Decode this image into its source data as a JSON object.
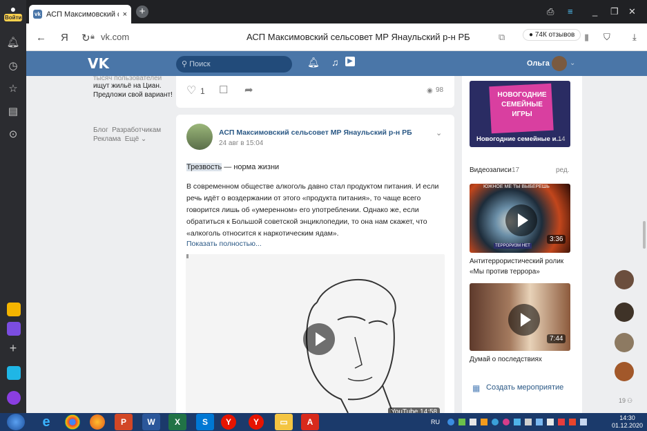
{
  "browser": {
    "login_label": "Войти",
    "tab_title": "АСП Максимовский се",
    "tab_close": "×",
    "new_tab": "+",
    "nav_back": "←",
    "nav_ya": "Я",
    "nav_reload": "↻",
    "url": "vk.com",
    "page_title": "АСП Максимовский сельсовет МР Янаульский р-н РБ",
    "reviews": "74К отзывов"
  },
  "vk": {
    "logo": "VK",
    "search_placeholder": "Поиск",
    "user_name": "Ольга"
  },
  "left": {
    "ad_line1": "тысяч пользователей",
    "ad_line2": "ищут жильё на Циан.",
    "ad_line3": "Предложи свой вариант!",
    "blog": "Блог",
    "developers": "Разработчикам",
    "ads": "Реклама",
    "more": "Ещё ⌄"
  },
  "prev_post": {
    "likes": "1",
    "views": "98"
  },
  "post": {
    "author": "АСП Максимовский сельсовет МР Янаульский р-н РБ",
    "date": "24 авг в 15:04",
    "headline_word": "Трезвость",
    "headline_rest": " — норма жизни",
    "body": "В современном обществе алкоголь давно стал продуктом питания. И если речь идёт о воздержании от этого «продукта питания», то чаще всего говорится лишь об «умеренном» его употреблении. Однако же, если обратиться к Большой советской энциклопедии, то она нам скажет, что «алкоголь относится к наркотическим ядам».",
    "show_more": "Показать полностью...",
    "video_badge": "YouTube 14:58"
  },
  "right": {
    "game_logo_line1": "НОВОГОДНИЕ",
    "game_logo_line2": "СЕМЕЙНЫЕ",
    "game_logo_line3": "ИГРЫ",
    "game_caption": "Новогодние семейные и...",
    "game_count": "14",
    "videos_title": "Видеозаписи",
    "videos_count": "17",
    "videos_edit": "ред.",
    "video1_banner": "ЮЖНОЕ МЕ ТЫ ВЫБЕРЕШЬ",
    "video1_duration": "3:36",
    "video1_brand": "ТЕРРОРИЗМ НЕТ",
    "video1_title": "Антитеррористический ролик «Мы против террора»",
    "video2_duration": "7:44",
    "video2_title": "Думай о последствиях",
    "create_event": "Создать мероприятие"
  },
  "friends": {
    "count": "19"
  },
  "taskbar": {
    "lang": "RU",
    "time": "14:30",
    "date": "01.12.2020"
  }
}
